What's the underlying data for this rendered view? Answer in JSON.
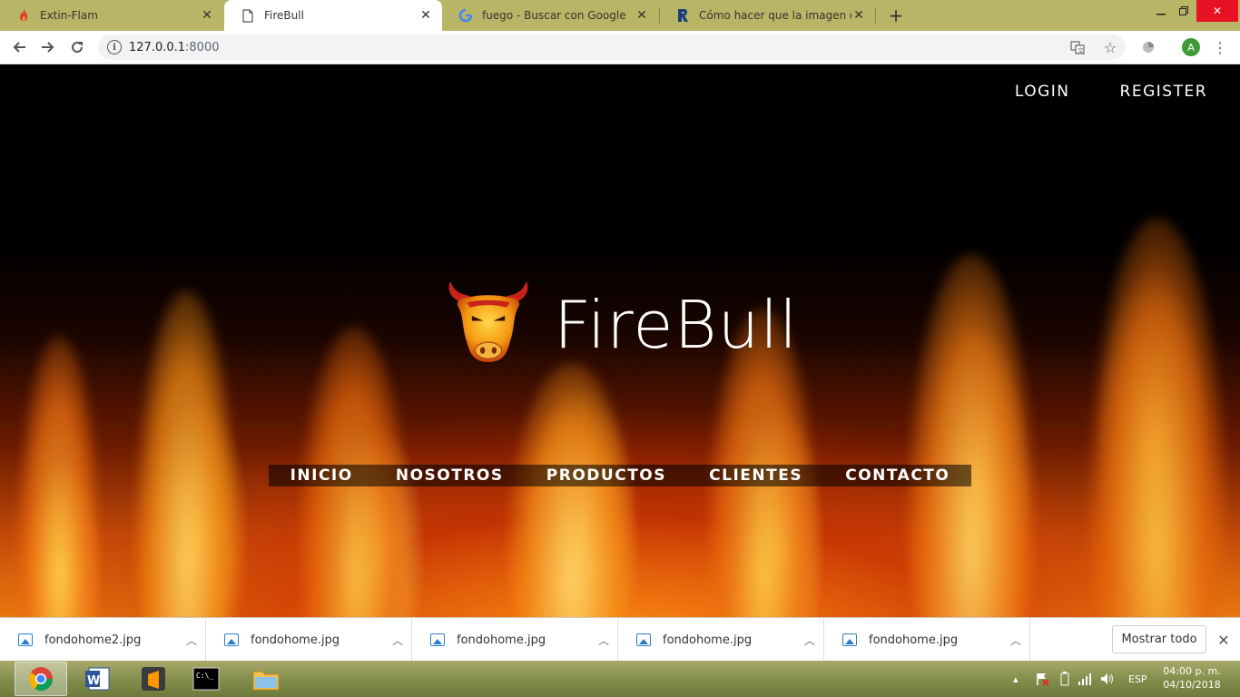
{
  "browser": {
    "tabs": [
      {
        "title": "Extin-Flam",
        "icon": "flame-favicon",
        "active": false
      },
      {
        "title": "FireBull",
        "icon": "page-icon",
        "active": true
      },
      {
        "title": "fuego - Buscar con Google",
        "icon": "google-icon",
        "active": false
      },
      {
        "title": "Cómo hacer que la imagen de fo",
        "icon": "r-logo-icon",
        "active": false
      }
    ],
    "url_host": "127.0.0.1",
    "url_port": ":8000",
    "profile_initial": "A"
  },
  "page": {
    "top_nav": {
      "login": "LOGIN",
      "register": "REGISTER"
    },
    "brand_name": "FireBull",
    "main_nav": [
      "INICIO",
      "NOSOTROS",
      "PRODUCTOS",
      "CLIENTES",
      "CONTACTO"
    ]
  },
  "downloads": {
    "items": [
      "fondohome2.jpg",
      "fondohome.jpg",
      "fondohome.jpg",
      "fondohome.jpg",
      "fondohome.jpg"
    ],
    "show_all": "Mostrar todo"
  },
  "taskbar": {
    "apps": [
      "chrome-icon",
      "word-icon",
      "sublime-icon",
      "cmd-icon",
      "explorer-icon"
    ],
    "language": "ESP",
    "time": "04:00 p. m.",
    "date": "04/10/2018"
  },
  "colors": {
    "tabstrip": "#b9b566",
    "fire_accent": "#e97a10",
    "taskbar": "#7f8a48"
  }
}
